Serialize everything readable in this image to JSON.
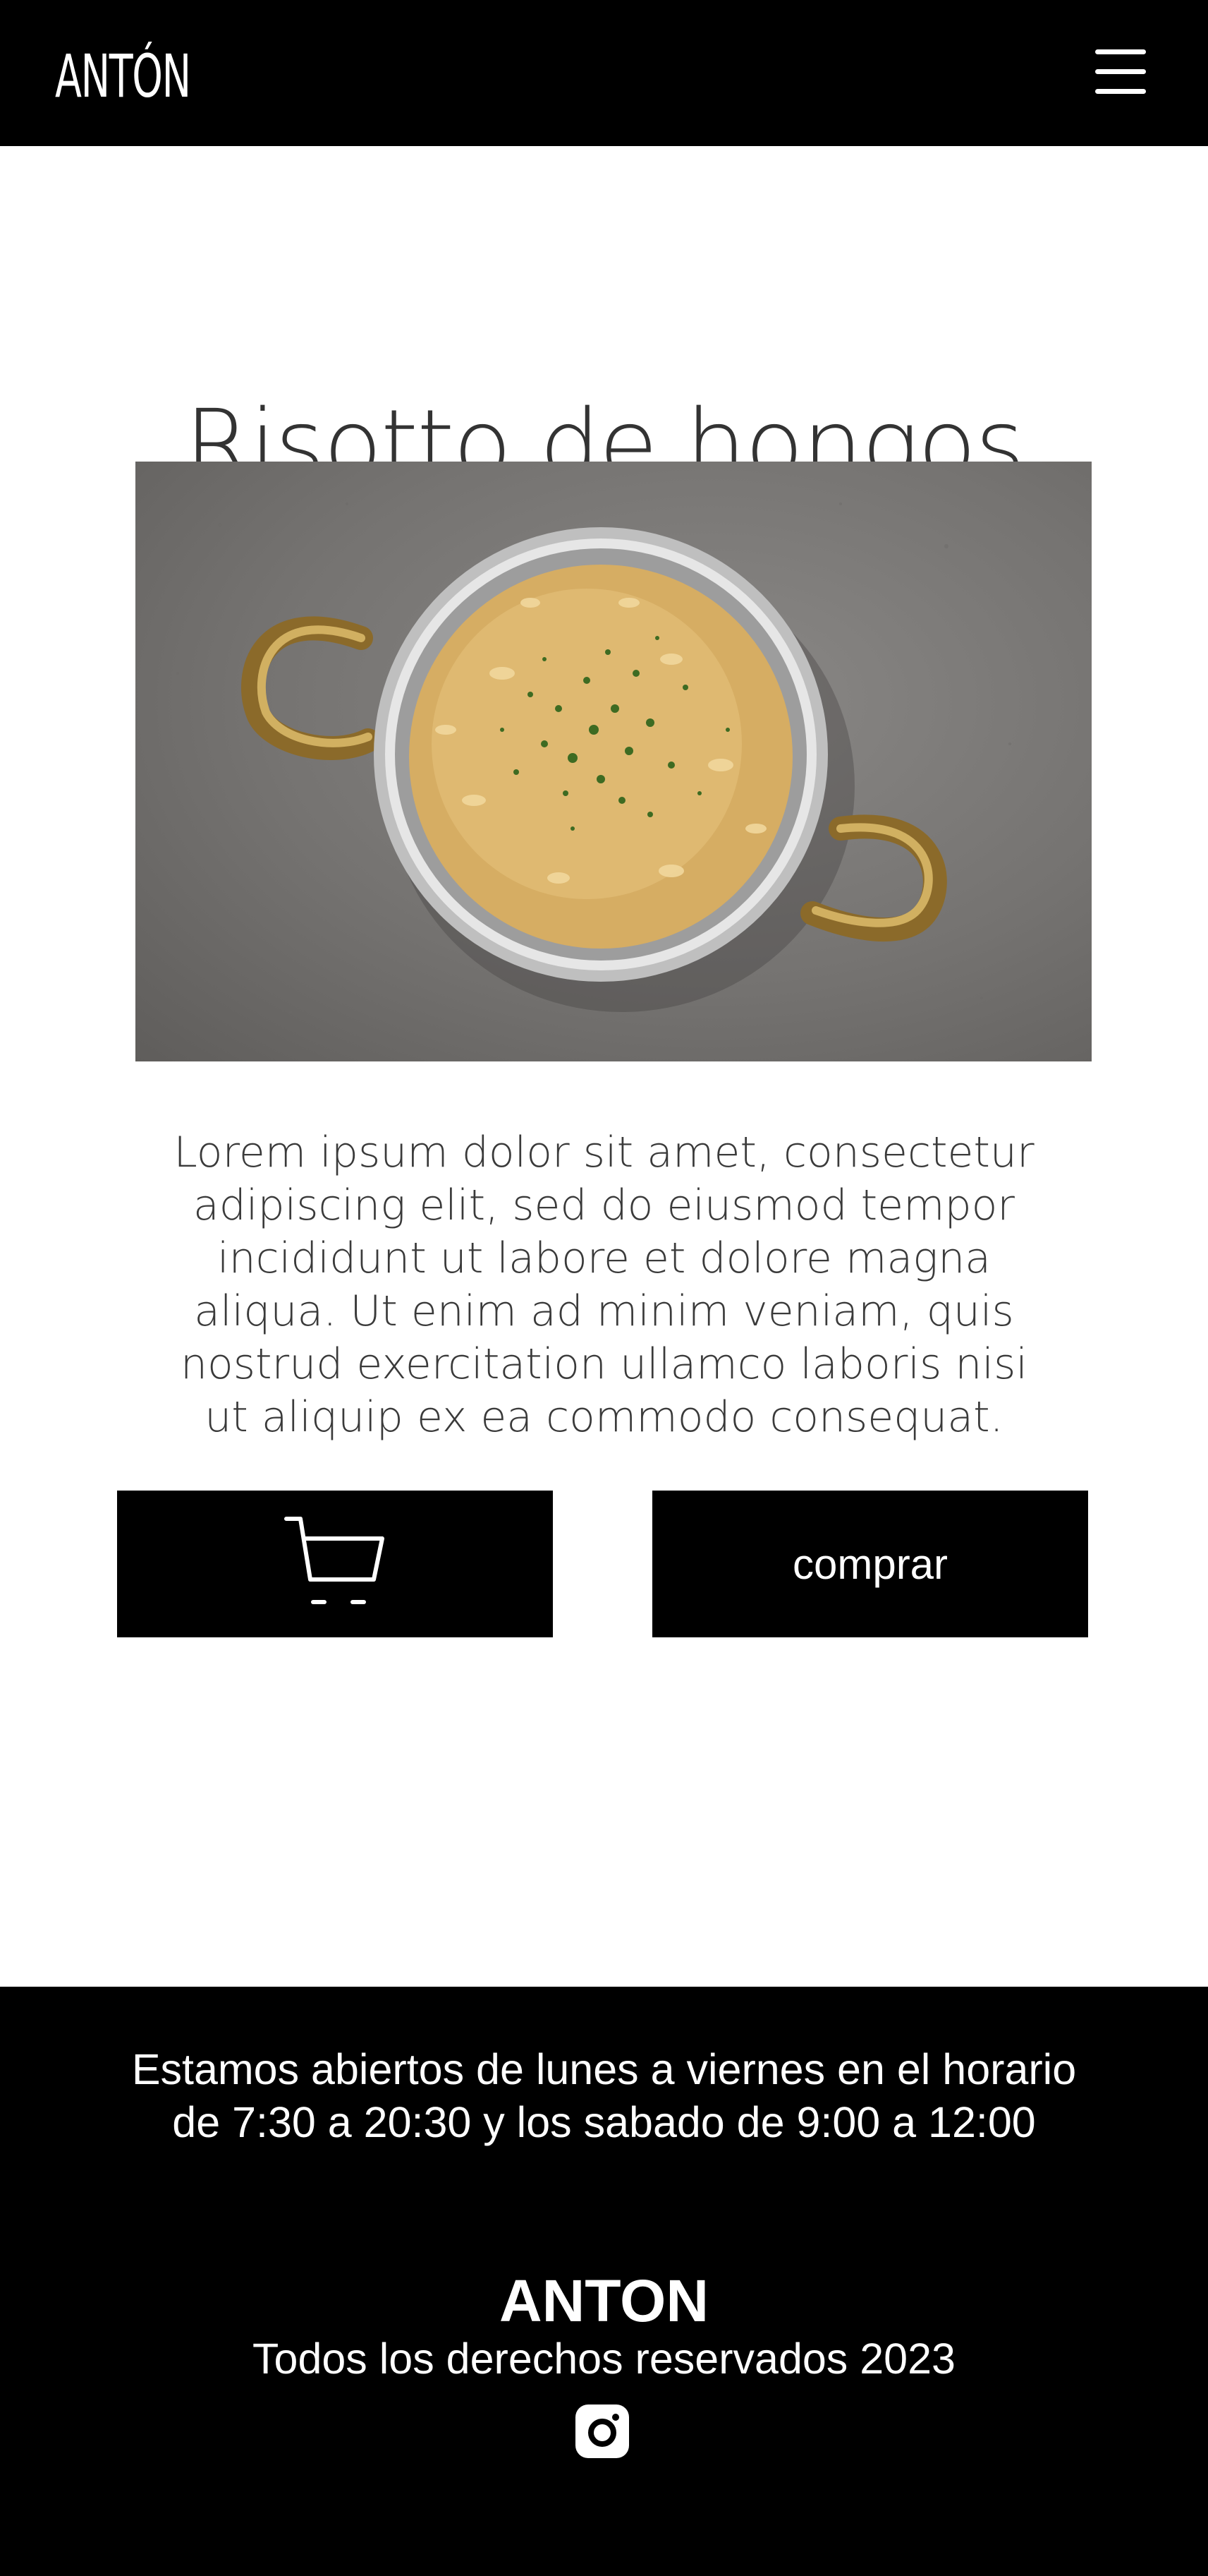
{
  "header": {
    "logo": "ANTÓN",
    "menu_icon": "hamburger-menu-icon"
  },
  "product": {
    "title": "Risotto de hongos",
    "image_alt": "Mushroom risotto in a pan",
    "description": "Lorem ipsum dolor sit amet, consectetur adipiscing elit, sed do eiusmod tempor incididunt ut labore et dolore magna aliqua. Ut enim ad minim veniam, quis nostrud exercitation ullamco laboris nisi ut aliquip ex ea commodo consequat.",
    "cart_icon": "shopping-cart-icon",
    "buy_label": "comprar"
  },
  "footer": {
    "hours": "Estamos abiertos de lunes a viernes en el horario de 7:30 a 20:30 y los sabado de 9:00 a 12:00",
    "brand": "ANTON",
    "rights": "Todos los derechos reservados 2023",
    "social_icon": "instagram-icon"
  },
  "colors": {
    "header_bg": "#000000",
    "footer_bg": "#000000",
    "button_bg": "#000000",
    "text_dark": "#333333",
    "text_light": "#ffffff"
  }
}
